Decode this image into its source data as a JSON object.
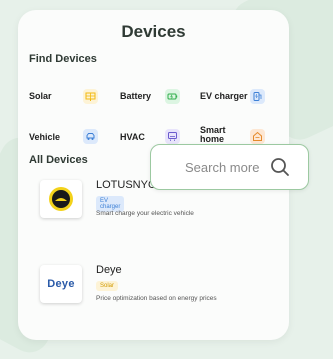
{
  "header": {
    "title": "Devices"
  },
  "find_devices": {
    "title": "Find Devices",
    "categories": [
      {
        "label": "Solar",
        "icon": "solar-icon",
        "color": "#f7c948"
      },
      {
        "label": "Battery",
        "icon": "battery-icon",
        "color": "#3cbf5a"
      },
      {
        "label": "EV charger",
        "icon": "ev-charger-icon",
        "color": "#4a90e2"
      },
      {
        "label": "Vehicle",
        "icon": "vehicle-icon",
        "color": "#4a90e2"
      },
      {
        "label": "HVAC",
        "icon": "hvac-icon",
        "color": "#7b68ee"
      },
      {
        "label": "Smart home",
        "icon": "smart-home-icon",
        "color": "#f2994a"
      }
    ]
  },
  "all_devices": {
    "title": "All Devices",
    "items": [
      {
        "name": "LOTUSNYO",
        "badge": "EV charger",
        "description": "Smart charge your electric vehicle",
        "logo": "lotus-logo"
      },
      {
        "name": "Deye",
        "badge": "Solar",
        "description": "Price optimization based on energy prices",
        "logo": "Deye"
      }
    ]
  },
  "search": {
    "placeholder": "Search more"
  }
}
